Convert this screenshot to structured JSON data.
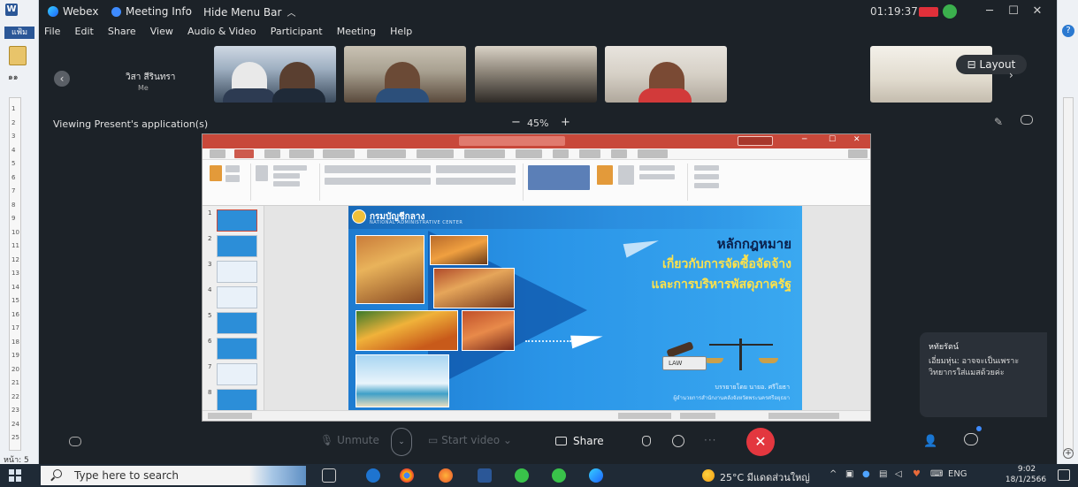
{
  "word": {
    "app_icon": "W",
    "tab": "แฟ้ม",
    "font_size": "๑๑",
    "ruler_marks": [
      "1",
      "2",
      "3",
      "4",
      "5",
      "6",
      "7",
      "8",
      "9",
      "10",
      "11",
      "12",
      "13",
      "14",
      "15",
      "16",
      "17",
      "18",
      "19",
      "20",
      "21",
      "22",
      "23",
      "24",
      "25"
    ],
    "page_indicator": "หน้า: 5"
  },
  "webex": {
    "app_name": "Webex",
    "meeting_info": "Meeting Info",
    "hide_menu_bar": "Hide Menu Bar",
    "clock": "01:19:37",
    "menu": [
      "File",
      "Edit",
      "Share",
      "View",
      "Audio & Video",
      "Participant",
      "Meeting",
      "Help"
    ],
    "self_name": "วิสา สีรินทรา",
    "self_label": "Me",
    "layout_label": "Layout",
    "viewing_label": "Viewing Present's application(s)",
    "zoom_level": "45%",
    "zoom_minus": "−",
    "zoom_plus": "+",
    "controls": {
      "unmute": "Unmute",
      "start_video": "Start video",
      "share": "Share"
    },
    "chat_popup": {
      "sender": "หทัยรัตน์",
      "message": "เอี่ยมหุ่น: อาจจะเป็นเพราะวิทยากรใส่แมสด้วยค่ะ"
    }
  },
  "slide": {
    "org_name": "กรมบัญชีกลาง",
    "org_sub": "NATIONAL ADMINISTRATIVE CENTER",
    "title_lines": [
      "หลักกฎหมาย",
      "เกี่ยวกับการจัดซื้อจัดจ้าง",
      "และการบริหารพัสดุภาครัฐ"
    ],
    "book_label": "LAW",
    "presenter": "บรรยายโดย นายอ. ศรีโยธา",
    "presenter_sub": "ผู้อำนวยการสำนักงานคลังจังหวัดพระนครศรีอยุธยา"
  },
  "ppt": {
    "slide_numbers": [
      "1",
      "2",
      "3",
      "4",
      "5",
      "6",
      "7",
      "8"
    ]
  },
  "taskbar": {
    "search_placeholder": "Type here to search",
    "weather": "25°C มีแดดส่วนใหญ่",
    "lang": "ENG",
    "time": "9:02",
    "date": "18/1/2566"
  }
}
